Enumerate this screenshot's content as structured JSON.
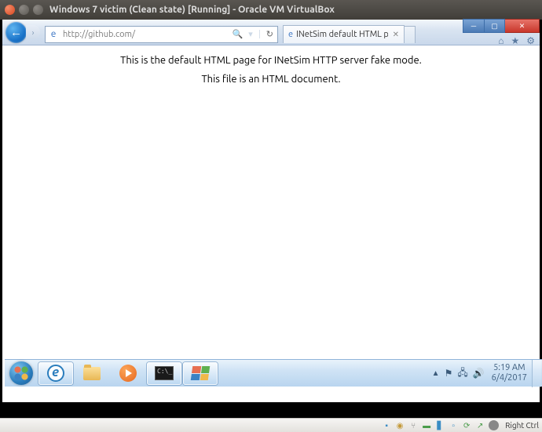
{
  "host": {
    "title": "Windows 7 victim (Clean state) [Running] - Oracle VM VirtualBox"
  },
  "ie": {
    "url": "http://github.com/",
    "tab_label": "INetSim default HTML page"
  },
  "page": {
    "line1": "This is the default HTML page for INetSim HTTP server fake mode.",
    "line2": "This file is an HTML document."
  },
  "tray": {
    "time": "5:19 AM",
    "date": "6/4/2017"
  },
  "vb": {
    "hostkey": "Right Ctrl"
  },
  "cmd_prompt": "C:\\_"
}
